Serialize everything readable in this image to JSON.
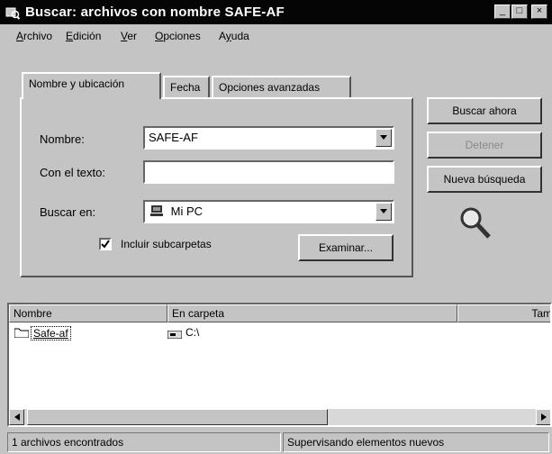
{
  "window": {
    "title": "Buscar: archivos con nombre SAFE-AF",
    "controls": {
      "minimize": "_",
      "maximize": "□",
      "close": "×"
    }
  },
  "menu": {
    "items": [
      {
        "label": "Archivo",
        "hotkey": "A",
        "rest": "rchivo"
      },
      {
        "label": "Edición",
        "hotkey": "E",
        "rest": "dición"
      },
      {
        "label": "Ver",
        "hotkey": "V",
        "rest": "er"
      },
      {
        "label": "Opciones",
        "hotkey": "O",
        "rest": "pciones"
      },
      {
        "label": "Ayuda",
        "hotkey": "y",
        "pre": "A",
        "rest": "uda"
      }
    ]
  },
  "tabs": [
    {
      "label": "Nombre y ubicación",
      "active": true
    },
    {
      "label": "Fecha",
      "active": false
    },
    {
      "label": "Opciones avanzadas",
      "active": false
    }
  ],
  "form": {
    "name_label": "Nombre:",
    "name_value": "SAFE-AF",
    "text_label": "Con el texto:",
    "text_value": "",
    "lookin_label": "Buscar en:",
    "lookin_value": "Mi PC",
    "include_subfolders_label": "Incluir subcarpetas",
    "include_subfolders_checked": true,
    "browse_label": "Examinar..."
  },
  "actions": {
    "find_now": "Buscar ahora",
    "stop": "Detener",
    "new_search": "Nueva búsqueda"
  },
  "results": {
    "columns": [
      "Nombre",
      "En carpeta",
      "Tam"
    ],
    "rows": [
      {
        "name": "Safe-af",
        "folder": "C:\\"
      }
    ]
  },
  "status": {
    "left": "1 archivos encontrados",
    "right": "Supervisando elementos nuevos"
  },
  "colors": {
    "face": "#c4c4c4",
    "titlebar": "#050505",
    "window": "#ffffff"
  },
  "icons": [
    "search-app-icon",
    "magnifier-icon",
    "my-computer-icon",
    "folder-icon",
    "drive-icon",
    "check-icon",
    "dropdown-arrow-icon",
    "scroll-left-icon",
    "scroll-right-icon"
  ]
}
